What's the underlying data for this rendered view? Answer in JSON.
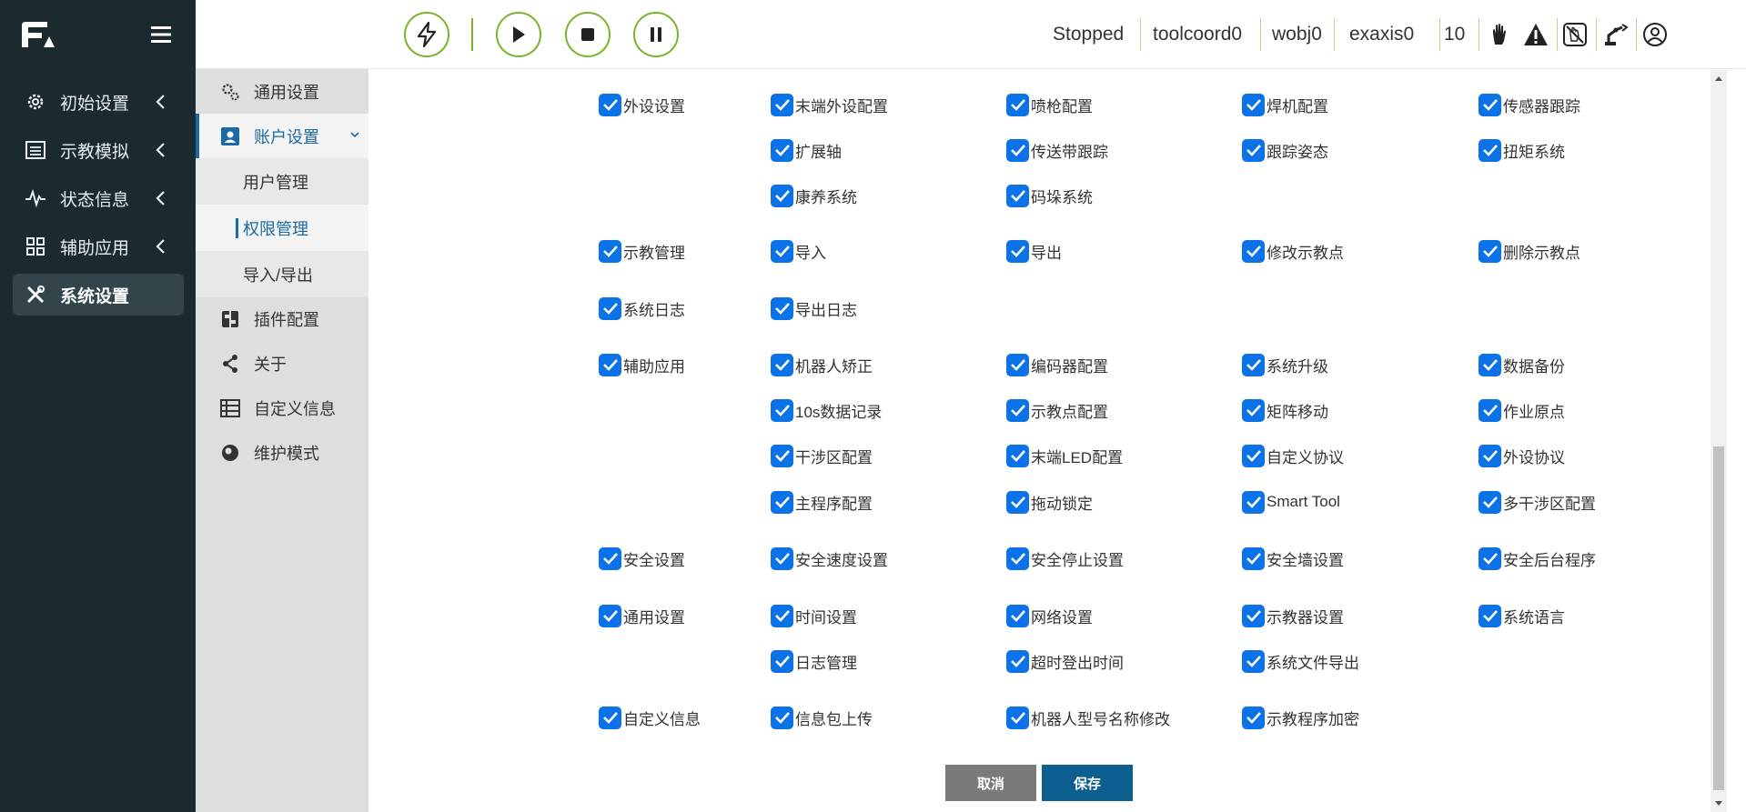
{
  "leftnav": {
    "items": [
      {
        "label": "初始设置",
        "icon": "gear-icon"
      },
      {
        "label": "示教模拟",
        "icon": "list-icon"
      },
      {
        "label": "状态信息",
        "icon": "pulse-icon"
      },
      {
        "label": "辅助应用",
        "icon": "grid-icon"
      },
      {
        "label": "系统设置",
        "icon": "tools-icon"
      }
    ]
  },
  "subnav": {
    "general": "通用设置",
    "account": "账户设置",
    "user_mgmt": "用户管理",
    "perm_mgmt": "权限管理",
    "import_export": "导入/导出",
    "plugin": "插件配置",
    "about": "关于",
    "custom_info": "自定义信息",
    "maintenance": "维护模式"
  },
  "topbar": {
    "status": "Stopped",
    "toolcoord": "toolcoord0",
    "wobj": "wobj0",
    "exaxis": "exaxis0",
    "speed": "10"
  },
  "permissions": {
    "r1": [
      "外设设置",
      "末端外设配置",
      "喷枪配置",
      "焊机配置",
      "传感器跟踪"
    ],
    "r2": [
      "扩展轴",
      "传送带跟踪",
      "跟踪姿态",
      "扭矩系统"
    ],
    "r3": [
      "康养系统",
      "码垛系统"
    ],
    "r4": [
      "示教管理",
      "导入",
      "导出",
      "修改示教点",
      "删除示教点"
    ],
    "r5": [
      "系统日志",
      "导出日志"
    ],
    "r6": [
      "辅助应用",
      "机器人矫正",
      "编码器配置",
      "系统升级",
      "数据备份"
    ],
    "r7": [
      "10s数据记录",
      "示教点配置",
      "矩阵移动",
      "作业原点"
    ],
    "r8": [
      "干涉区配置",
      "末端LED配置",
      "自定义协议",
      "外设协议"
    ],
    "r9": [
      "主程序配置",
      "拖动锁定",
      "Smart Tool",
      "多干涉区配置"
    ],
    "r10": [
      "安全设置",
      "安全速度设置",
      "安全停止设置",
      "安全墙设置",
      "安全后台程序"
    ],
    "r11": [
      "通用设置",
      "时间设置",
      "网络设置",
      "示教器设置",
      "系统语言"
    ],
    "r12": [
      "日志管理",
      "超时登出时间",
      "系统文件导出"
    ],
    "r13": [
      "自定义信息",
      "信息包上传",
      "机器人型号名称修改",
      "示教程序加密"
    ]
  },
  "buttons": {
    "cancel": "取消",
    "save": "保存"
  },
  "colors": {
    "nav_bg": "#1b2a2f",
    "accent_green": "#7ab32a",
    "checkbox_blue": "#0b72e7",
    "save_blue": "#0d5f8f"
  }
}
